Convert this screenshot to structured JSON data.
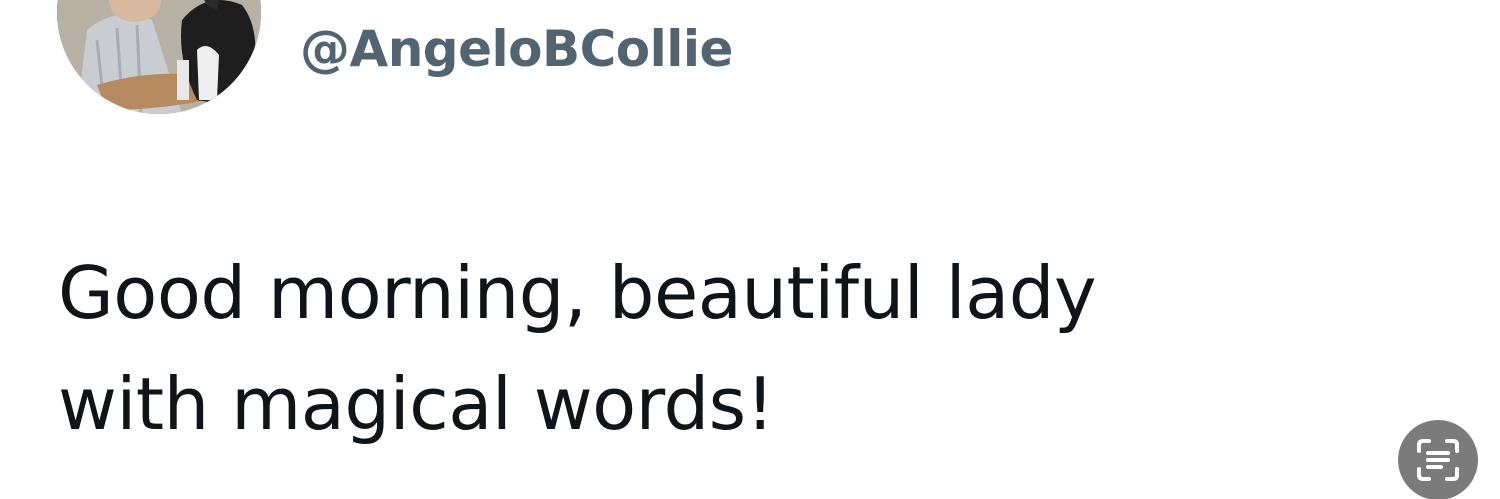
{
  "tweet": {
    "display_name": "",
    "handle": "@AngeloBCollie",
    "text_lines": [
      "Good morning, beautiful lady",
      "with magical words!"
    ]
  },
  "avatar": {
    "icon": "profile-photo-man-with-dog"
  },
  "overlay": {
    "icon": "live-text-scan-icon"
  },
  "colors": {
    "background": "#ffffff",
    "text_primary": "#0f1419",
    "text_secondary": "#536471",
    "badge": "#7b7b7b"
  }
}
